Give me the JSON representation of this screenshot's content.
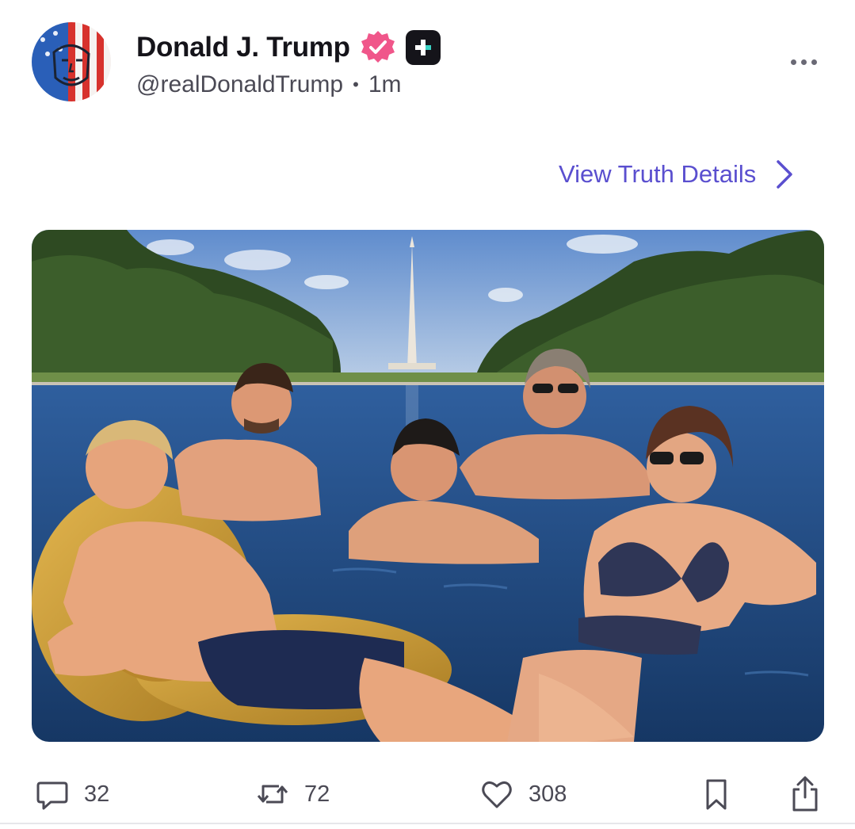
{
  "author": {
    "display_name": "Donald J. Trump",
    "handle": "@realDonaldTrump",
    "separator": "•",
    "timestamp": "1m",
    "avatar_icon": "flag-face-avatar",
    "verified_icon": "verified-badge-icon",
    "plus_icon": "truth-plus-badge-icon"
  },
  "menu": {
    "icon": "more-options-icon"
  },
  "details_link": {
    "label": "View Truth Details",
    "icon": "chevron-right-icon"
  },
  "media": {
    "kind": "photo",
    "icon": "post-photo"
  },
  "actions": {
    "replies": {
      "count": "32",
      "icon": "reply-icon"
    },
    "retruths": {
      "count": "72",
      "icon": "retruth-icon"
    },
    "likes": {
      "count": "308",
      "icon": "heart-icon"
    },
    "bookmark": {
      "icon": "bookmark-icon"
    },
    "share": {
      "icon": "share-icon"
    }
  },
  "colors": {
    "accent": "#5a4fcf",
    "verified": "#f0568a",
    "text": "#15141a",
    "muted": "#4b4a55"
  }
}
